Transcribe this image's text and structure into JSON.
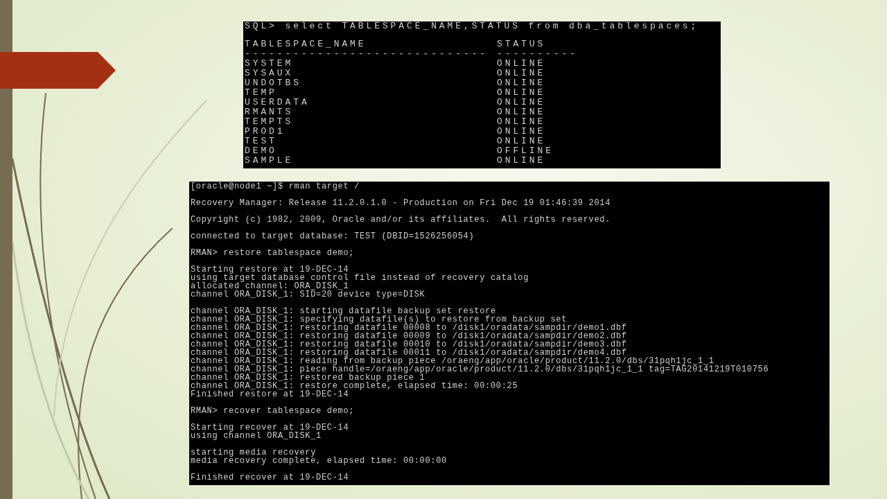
{
  "sql_terminal": {
    "command": "SQL> select TABLESPACE_NAME,STATUS from dba_tablespaces;",
    "columns": [
      {
        "heading": "TABLESPACE_NAME",
        "rule": "------------------------------"
      },
      {
        "heading": "STATUS",
        "rule": "----------"
      }
    ],
    "rows": [
      {
        "name": "SYSTEM",
        "status": "ONLINE"
      },
      {
        "name": "SYSAUX",
        "status": "ONLINE"
      },
      {
        "name": "UNDOTBS",
        "status": "ONLINE"
      },
      {
        "name": "TEMP",
        "status": "ONLINE"
      },
      {
        "name": "USERDATA",
        "status": "ONLINE"
      },
      {
        "name": "RMANTS",
        "status": "ONLINE"
      },
      {
        "name": "TEMPTS",
        "status": "ONLINE"
      },
      {
        "name": "PROD1",
        "status": "ONLINE"
      },
      {
        "name": "TEST",
        "status": "ONLINE"
      },
      {
        "name": "DEMO",
        "status": "OFFLINE"
      },
      {
        "name": "SAMPLE",
        "status": "ONLINE"
      }
    ]
  },
  "rman_terminal": {
    "blocks": [
      [
        "[oracle@node1 ~]$ rman target /"
      ],
      [
        "Recovery Manager: Release 11.2.0.1.0 - Production on Fri Dec 19 01:46:39 2014"
      ],
      [
        "Copyright (c) 1982, 2009, Oracle and/or its affiliates.  All rights reserved."
      ],
      [
        "connected to target database: TEST (DBID=1526256054)"
      ],
      [
        "RMAN> restore tablespace demo;"
      ],
      [
        "Starting restore at 19-DEC-14",
        "using target database control file instead of recovery catalog",
        "allocated channel: ORA_DISK_1",
        "channel ORA_DISK_1: SID=20 device type=DISK"
      ],
      [
        "channel ORA_DISK_1: starting datafile backup set restore",
        "channel ORA_DISK_1: specifying datafile(s) to restore from backup set",
        "channel ORA_DISK_1: restoring datafile 00008 to /disk1/oradata/sampdir/demo1.dbf",
        "channel ORA_DISK_1: restoring datafile 00009 to /disk1/oradata/sampdir/demo2.dbf",
        "channel ORA_DISK_1: restoring datafile 00010 to /disk1/oradata/sampdir/demo3.dbf",
        "channel ORA_DISK_1: restoring datafile 00011 to /disk1/oradata/sampdir/demo4.dbf",
        "channel ORA_DISK_1: reading from backup piece /oraeng/app/oracle/product/11.2.0/dbs/31pqh1jc_1_1",
        "channel ORA_DISK_1: piece handle=/oraeng/app/oracle/product/11.2.0/dbs/31pqh1jc_1_1 tag=TAG20141219T010756",
        "channel ORA_DISK_1: restored backup piece 1",
        "channel ORA_DISK_1: restore complete, elapsed time: 00:00:25",
        "Finished restore at 19-DEC-14"
      ],
      [
        "RMAN> recover tablespace demo;"
      ],
      [
        "Starting recover at 19-DEC-14",
        "using channel ORA_DISK_1"
      ],
      [
        "starting media recovery",
        "media recovery complete, elapsed time: 00:00:00"
      ],
      [
        "Finished recover at 19-DEC-14"
      ]
    ]
  }
}
